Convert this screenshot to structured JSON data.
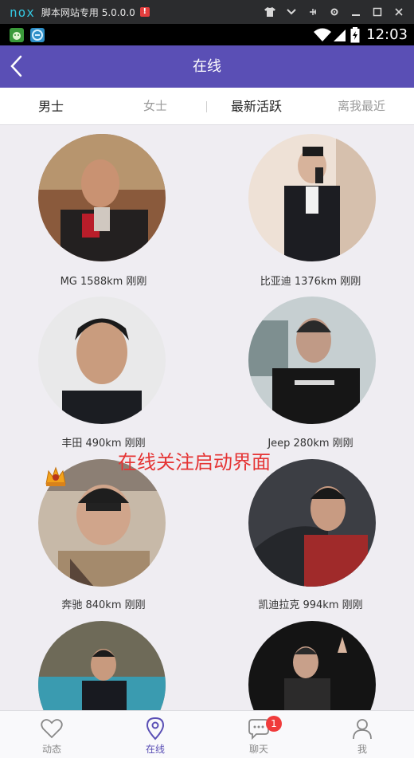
{
  "emulator": {
    "logo": "nox",
    "title": "脚本网站专用 5.0.0.0",
    "warning": "!"
  },
  "status_bar": {
    "time": "12:03"
  },
  "header": {
    "title": "在线"
  },
  "filters": {
    "male": "男士",
    "female": "女士",
    "latest": "最新活跃",
    "nearest": "离我最近"
  },
  "users": [
    {
      "label": "MG 1588km 刚刚"
    },
    {
      "label": "比亚迪 1376km 刚刚"
    },
    {
      "label": "丰田 490km 刚刚"
    },
    {
      "label": "Jeep 280km 刚刚"
    },
    {
      "label": "奔驰 840km 刚刚"
    },
    {
      "label": "凯迪拉克 994km 刚刚"
    },
    {
      "label": ""
    },
    {
      "label": ""
    }
  ],
  "overlay_text": "在线关注启动界面",
  "bottom_nav": {
    "items": [
      {
        "label": "动态",
        "icon": "heart-icon"
      },
      {
        "label": "在线",
        "icon": "location-pin-icon"
      },
      {
        "label": "聊天",
        "icon": "chat-bubble-icon",
        "badge": "1"
      },
      {
        "label": "我",
        "icon": "person-icon"
      }
    ]
  },
  "colors": {
    "primary": "#5a4fb5",
    "badge": "#f03b3b",
    "overlay": "#e53434"
  }
}
